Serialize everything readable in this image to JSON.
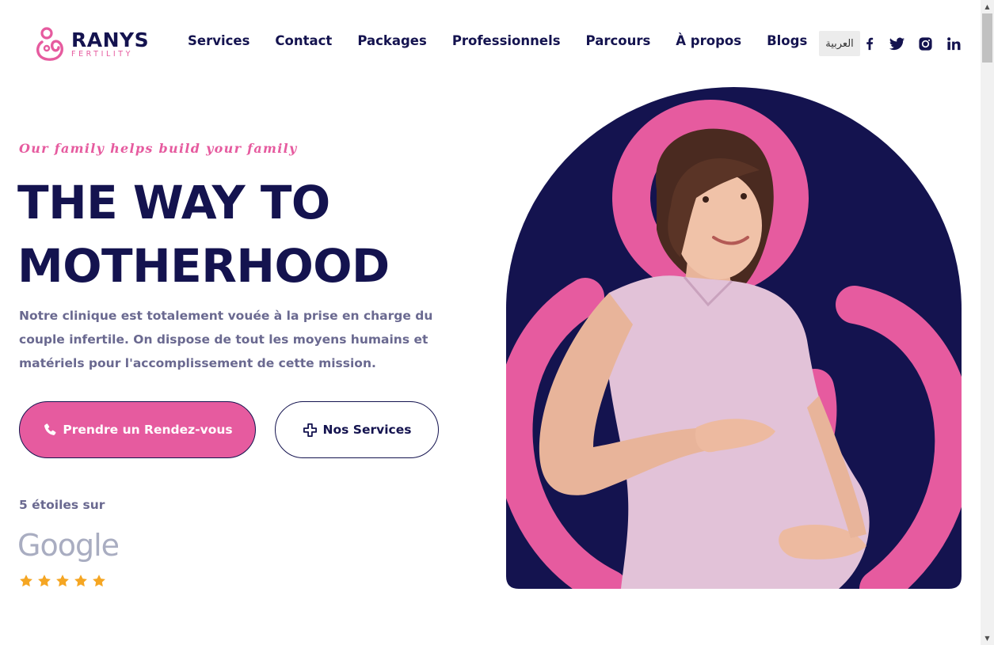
{
  "brand": {
    "name": "RANYS",
    "sub": "FERTILITY",
    "pink": "#e65b9f",
    "navy": "#14134f"
  },
  "nav": {
    "items": [
      "Services",
      "Contact",
      "Packages",
      "Professionnels",
      "Parcours",
      "À propos",
      "Blogs"
    ]
  },
  "header": {
    "lang_label": "العربية",
    "social_icons": [
      "facebook-icon",
      "twitter-icon",
      "instagram-icon",
      "linkedin-icon"
    ]
  },
  "hero": {
    "tagline": "Our family helps build your family",
    "title_line1": "THE WAY TO",
    "title_line2": "MOTHERHOOD",
    "description": "Notre clinique est totalement vouée à la prise en charge du couple infertile. On dispose de tout les moyens humains et matériels pour l'accomplissement de cette mission.",
    "cta_primary": "Prendre un Rendez-vous",
    "cta_secondary": "Nos Services",
    "rating_label": "5 étoiles sur",
    "rating_source": "Google",
    "rating_stars": 5,
    "star_color": "#f5a623"
  }
}
